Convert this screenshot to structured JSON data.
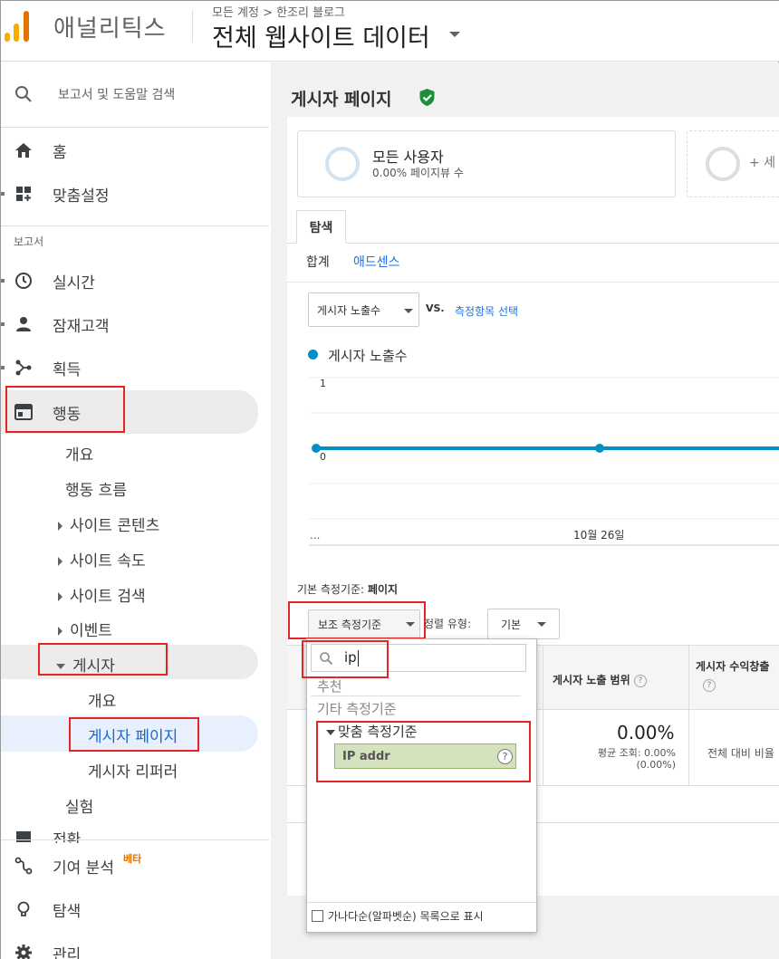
{
  "header": {
    "app_name": "애널리틱스",
    "breadcrumb": "모든 계정 > 한조리 블로그",
    "property_name": "전체 웹사이트 데이터"
  },
  "sidebar": {
    "search_label": "보고서 및 도움말 검색",
    "home": "홈",
    "customization": "맞춤설정",
    "reports_section": "보고서",
    "realtime": "실시간",
    "audience": "잠재고객",
    "acquisition": "획득",
    "behavior": "행동",
    "behavior_items": {
      "overview": "개요",
      "flow": "행동 흐름",
      "site_content": "사이트 콘텐츠",
      "site_speed": "사이트 속도",
      "site_search": "사이트 검색",
      "events": "이벤트",
      "publisher": "게시자",
      "publisher_overview": "개요",
      "publisher_pages": "게시자 페이지",
      "publisher_referrers": "게시자 리퍼러",
      "experiments": "실험",
      "conversions_partial": "전환"
    },
    "attribution": "기여 분석",
    "attribution_badge": "베타",
    "discover": "탐색",
    "admin": "관리"
  },
  "main": {
    "page_title": "게시자 페이지",
    "segment_all_users": "모든 사용자",
    "segment_stat": "0.00% 페이지뷰 수",
    "segment_add": "+ 세",
    "tab_explore": "탐색",
    "subtab_total": "합계",
    "subtab_adsense": "애드센스",
    "metric_select": "게시자 노출수",
    "vs_label": "VS.",
    "select_metric_link": "측정항목 선택",
    "legend_label": "게시자 노출수",
    "primary_dimension_label": "기본 측정기준:",
    "primary_dimension_value": "페이지",
    "secondary_dimension_button": "보조 측정기준",
    "sort_type_label": "정렬 유형:",
    "sort_type_value": "기본",
    "col_impression_coverage": "게시자 노출 범위",
    "col_revenue": "게시자 수익창출",
    "big_value": "0.00%",
    "avg_view_label": "평균 조회: 0.00%",
    "avg_view_paren": "(0.00%)",
    "total_ratio_label": "전체 대비 비율"
  },
  "chart_data": {
    "type": "line",
    "series": [
      {
        "name": "게시자 노출수",
        "x_positions": [
          0,
          1,
          2
        ],
        "values": [
          0,
          0,
          0
        ]
      }
    ],
    "y_ticks": [
      "1",
      "0"
    ],
    "x_tick_label": "10월 26일",
    "x_ellipsis": "...",
    "ylim": [
      0,
      1
    ],
    "color": "#058dc7"
  },
  "popup": {
    "search_value": "ip",
    "recommended": "추천",
    "other_dimensions": "기타 측정기준",
    "custom_dimensions": "맞춤 측정기준",
    "ip_addr": "IP addr",
    "footer_checkbox": "가나다순(알파벳순) 목록으로 표시"
  },
  "colors": {
    "accent_blue": "#1a73e8",
    "chart_blue": "#058dc7",
    "highlight_red": "#e52525",
    "selected_green": "#d5e2be",
    "logo_orange": "#f9ab00"
  }
}
